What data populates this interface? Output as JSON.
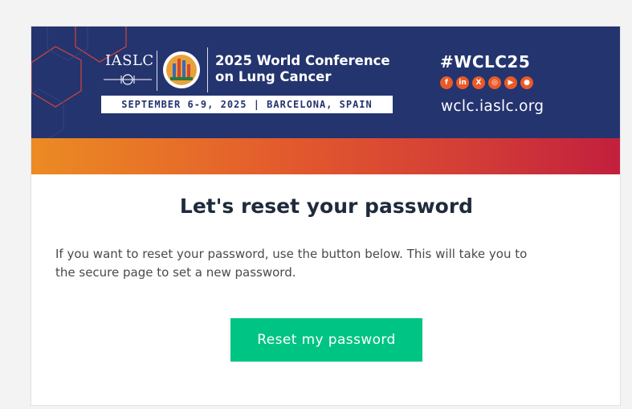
{
  "banner": {
    "org_name": "IASLC",
    "conference_title_line1": "2025 World Conference",
    "conference_title_line2": "on Lung Cancer",
    "dates_location": "SEPTEMBER 6-9, 2025  |  BARCELONA, SPAIN",
    "hashtag": "#WCLC25",
    "website": "wclc.iaslc.org",
    "social_icons": [
      "facebook-icon",
      "linkedin-icon",
      "x-icon",
      "instagram-icon",
      "youtube-icon",
      "wechat-icon"
    ],
    "colors": {
      "navy": "#24346f",
      "gradient_start": "#ec8b23",
      "gradient_end": "#c21f3d",
      "social": "#e95a28"
    }
  },
  "main": {
    "heading": "Let's reset your password",
    "body_line1": "If you want to reset your password, use the button below. This will take you to",
    "body_line2": "the secure page to set a new password.",
    "button_label": "Reset my password",
    "button_color": "#00c483"
  }
}
